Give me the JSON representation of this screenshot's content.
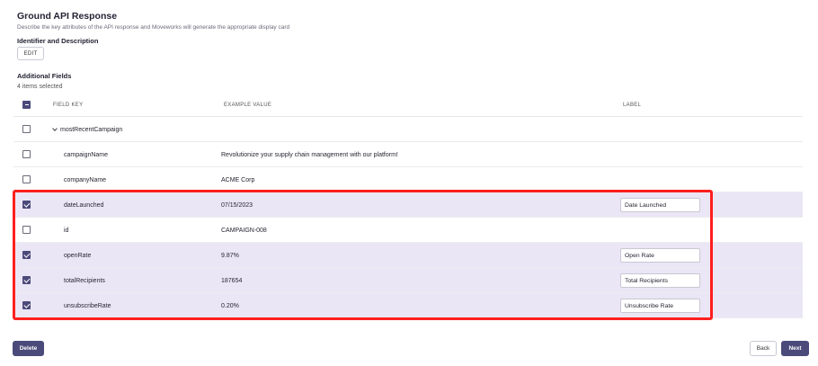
{
  "header": {
    "title": "Ground API Response",
    "subtitle": "Describe the key attributes of the API response and Moveworks will generate the appropriate display card"
  },
  "identifier": {
    "label": "Identifier and Description",
    "edit_label": "EDIT"
  },
  "additional": {
    "label": "Additional Fields",
    "count_text": "4 items selected"
  },
  "table": {
    "headers": {
      "field_key": "FIELD KEY",
      "example_value": "EXAMPLE VALUE",
      "label": "LABEL"
    },
    "rows": [
      {
        "key": "mostRecentCampaign",
        "value": "",
        "label": "",
        "checked": false,
        "group": true
      },
      {
        "key": "campaignName",
        "value": "Revolutionize your supply chain management with our platform!",
        "label": "",
        "checked": false
      },
      {
        "key": "companyName",
        "value": "ACME Corp",
        "label": "",
        "checked": false
      },
      {
        "key": "dateLaunched",
        "value": "07/15/2023",
        "label": "Date Launched",
        "checked": true
      },
      {
        "key": "id",
        "value": "CAMPAIGN-008",
        "label": "",
        "checked": false
      },
      {
        "key": "openRate",
        "value": "9.87%",
        "label": "Open Rate",
        "checked": true
      },
      {
        "key": "totalRecipients",
        "value": "187654",
        "label": "Total Recipients",
        "checked": true
      },
      {
        "key": "unsubscribeRate",
        "value": "0.20%",
        "label": "Unsubscribe Rate",
        "checked": true
      }
    ]
  },
  "footer": {
    "delete_label": "Delete",
    "back_label": "Back",
    "next_label": "Next"
  },
  "colors": {
    "primary": "#4b4a7a",
    "selected_row": "#ebe6f6",
    "highlight": "#ff1f1f"
  }
}
